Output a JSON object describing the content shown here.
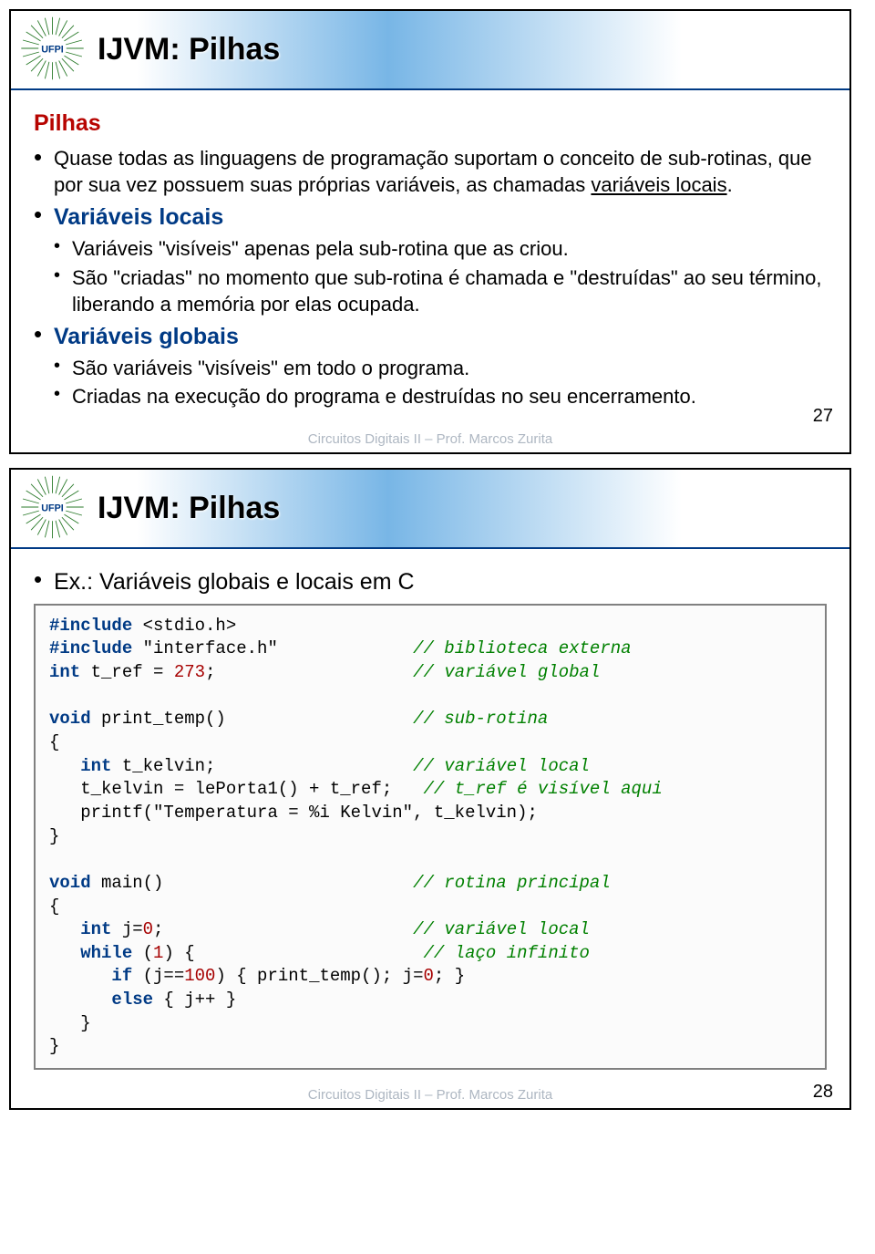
{
  "slide27": {
    "title": "IJVM: Pilhas",
    "section": "Pilhas",
    "b1": "Quase todas as linguagens de programação suportam o conceito de sub-rotinas, que por sua vez possuem suas próprias variáveis, as chamadas ",
    "b1u": "variáveis locais",
    "b1end": ".",
    "h2": "Variáveis locais",
    "b2a": "Variáveis \"visíveis\" apenas pela sub-rotina que as criou.",
    "b2b": "São \"criadas\" no momento que sub-rotina é chamada e \"destruídas\" ao seu término, liberando a memória por elas ocupada.",
    "h3": "Variáveis globais",
    "b3a": "São variáveis \"visíveis\" em todo o programa.",
    "b3b": "Criadas na execução do programa e destruídas no seu encerramento.",
    "footer": "Circuitos Digitais II – Prof. Marcos Zurita",
    "page": "27"
  },
  "slide28": {
    "title": "IJVM: Pilhas",
    "intro": "Ex.: Variáveis globais e locais em C",
    "code": {
      "l1a": "#include",
      "l1b": " <stdio.h>",
      "l2a": "#include",
      "l2b": " \"interface.h\"",
      "l2c": "// biblioteca externa",
      "l3a": "int",
      "l3b": " t_ref = ",
      "l3c": "273",
      "l3d": ";",
      "l3e": "// variável global",
      "l5a": "void",
      "l5b": " print_temp()",
      "l5c": "// sub-rotina",
      "l6": "{",
      "l7a": "   int",
      "l7b": " t_kelvin;",
      "l7c": "// variável local",
      "l8a": "   t_kelvin = lePorta1() + t_ref;",
      "l8b": "// t_ref é visível aqui",
      "l9": "   printf(\"Temperatura = %i Kelvin\", t_kelvin);",
      "l10": "}",
      "l12a": "void",
      "l12b": " main()",
      "l12c": "// rotina principal",
      "l13": "{",
      "l14a": "   int",
      "l14b": " j=",
      "l14c": "0",
      "l14d": ";",
      "l14e": "// variável local",
      "l15a": "   while",
      "l15b": " (",
      "l15c": "1",
      "l15d": ") {",
      "l15e": "// laço infinito",
      "l16a": "      if",
      "l16b": " (j==",
      "l16c": "100",
      "l16d": ") { print_temp(); j=",
      "l16e": "0",
      "l16f": "; }",
      "l17a": "      else",
      "l17b": " { j++ }",
      "l18": "   }",
      "l19": "}"
    },
    "footer": "Circuitos Digitais II – Prof. Marcos Zurita",
    "page": "28"
  },
  "logo_label": "UFPI"
}
